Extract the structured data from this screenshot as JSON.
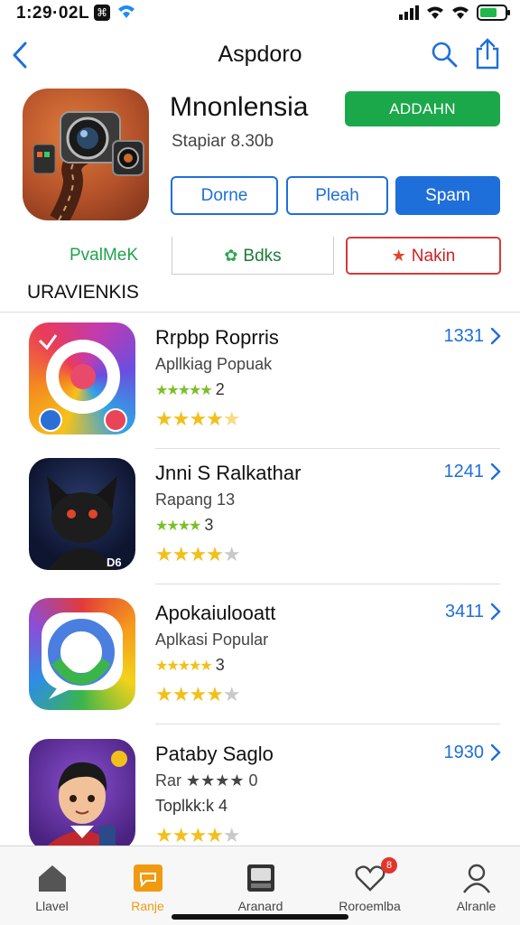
{
  "status_bar": {
    "time": "1:29·02L",
    "app_glyph": "⌘"
  },
  "nav": {
    "title": "Aspdoro"
  },
  "hero": {
    "title": "Mnonlensia",
    "subtitle": "Stapiar 8.30b",
    "primary_button": "ADDAHN",
    "buttons": [
      "Dorne",
      "Pleah",
      "Spam"
    ]
  },
  "segments": [
    {
      "label": "PvalMeK",
      "icon": ""
    },
    {
      "label": "Bdks",
      "icon": "leaf-icon"
    },
    {
      "label": "Nakin",
      "icon": "star-icon"
    }
  ],
  "section": {
    "heading": "URAVIENKIS"
  },
  "apps": [
    {
      "title": "Rrpbp Roprris",
      "sub1": "Apllkiag Popuak",
      "sub2_stars": "★★★★★",
      "sub2_text": "2",
      "rating": 4.5,
      "count": "1331",
      "icon": "camera-ring-icon"
    },
    {
      "title": "Jnni S Ralkathar",
      "sub1": "Rapang 13",
      "sub2_stars": "★★★★",
      "sub2_text": "3",
      "rating": 4,
      "count": "1241",
      "icon": "bat-mascot-icon"
    },
    {
      "title": "Apokaiulooatt",
      "sub1": "Aplkasi Popular",
      "sub2_stars": "★★★★★",
      "sub2_text": "3",
      "rating": 4,
      "count": "3411",
      "icon": "chat-rainbow-icon"
    },
    {
      "title": "Pataby Saglo",
      "sub1": "Rar ★★★★ 0",
      "sub2_stars": "",
      "sub2_text": "Toplkk:k 4",
      "rating": 4,
      "count": "1930",
      "icon": "avatar-boy-icon"
    }
  ],
  "tabs": [
    {
      "label": "Llavel",
      "icon": "home-icon"
    },
    {
      "label": "Ranje",
      "icon": "chat-bubble-icon",
      "active": true
    },
    {
      "label": "Aranard",
      "icon": "cassette-icon"
    },
    {
      "label": "Roroemlba",
      "icon": "heart-icon",
      "badge": "8"
    },
    {
      "label": "Alranle",
      "icon": "person-icon"
    }
  ],
  "colors": {
    "accent_blue": "#1e6fd9",
    "primary_green": "#1ba84a",
    "tab_active": "#f09a12",
    "star": "#f2c01b"
  }
}
